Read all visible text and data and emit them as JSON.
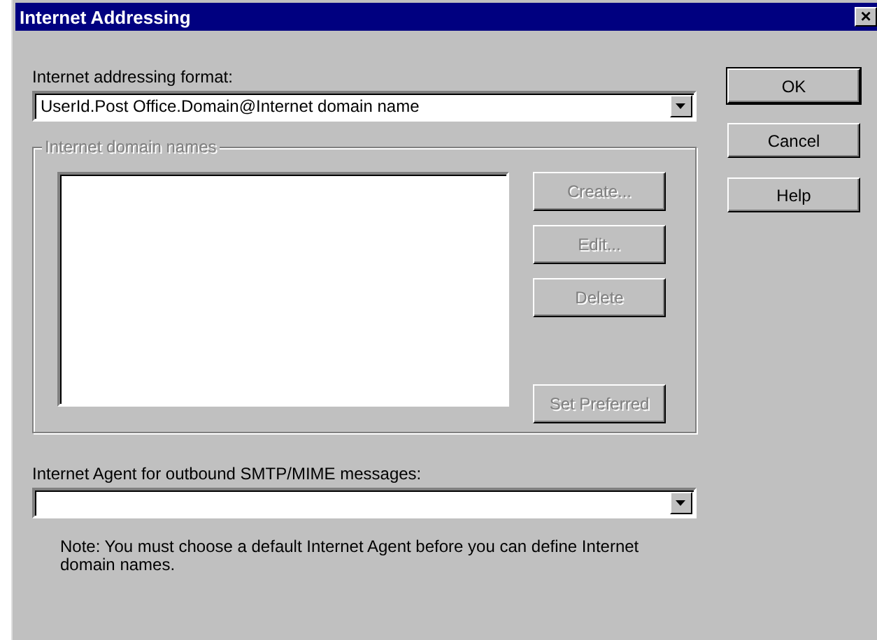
{
  "window": {
    "title": "Internet Addressing",
    "close": "×"
  },
  "format": {
    "label": "Internet addressing format:",
    "value": "UserId.Post Office.Domain@Internet domain name"
  },
  "dialog_buttons": [
    {
      "label": "OK",
      "default": true
    },
    {
      "label": "Cancel",
      "default": false
    },
    {
      "label": "Help",
      "default": false
    }
  ],
  "domain_group": {
    "label": "Internet domain names",
    "disabled": true,
    "buttons": [
      {
        "label": "Create...",
        "disabled": true
      },
      {
        "label": "Edit...",
        "disabled": true
      },
      {
        "label": "Delete",
        "disabled": true
      },
      {
        "label": "Set Preferred",
        "disabled": true
      }
    ]
  },
  "agent": {
    "label": "Internet Agent for outbound SMTP/MIME messages:"
  },
  "note": "Note:  You must choose a default Internet Agent before you can define Internet domain names."
}
